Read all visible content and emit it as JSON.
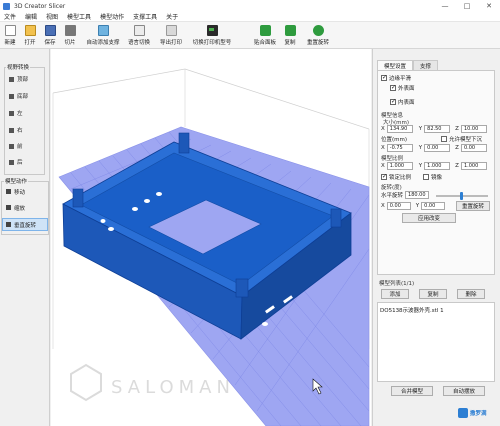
{
  "window": {
    "title": "3D Creator Slicer",
    "controls": [
      "—",
      "□",
      "✕"
    ]
  },
  "menu": [
    "文件",
    "编辑",
    "视图",
    "模型工具",
    "模型动作",
    "支撑工具",
    "关于"
  ],
  "toolbar": [
    {
      "label": "新建",
      "icon": "new-file-icon"
    },
    {
      "label": "打开",
      "icon": "folder-open-icon"
    },
    {
      "label": "保存",
      "icon": "save-icon"
    },
    {
      "label": "切片",
      "icon": "slice-icon"
    },
    {
      "label": "自动添加支撑",
      "icon": "auto-support-icon"
    },
    {
      "label": "语言切换",
      "icon": "language-icon"
    },
    {
      "label": "导出打印",
      "icon": "export-print-icon"
    },
    {
      "label": "切换打印机型号",
      "icon": "printer-icon"
    },
    {
      "label": "贴合面板",
      "icon": "fit-panel-icon"
    },
    {
      "label": "复制",
      "icon": "copy-icon"
    },
    {
      "label": "重置旋转",
      "icon": "reset-rotation-icon"
    }
  ],
  "left": {
    "view_title": "视野转换",
    "views": [
      "顶部",
      "底部",
      "左",
      "右",
      "前",
      "后"
    ],
    "action_title": "模型动作",
    "actions": [
      {
        "label": "移动",
        "selected": false
      },
      {
        "label": "缩放",
        "selected": false
      },
      {
        "label": "垂直旋转",
        "selected": true
      }
    ]
  },
  "right": {
    "tabs": [
      "模型设置",
      "支撑"
    ],
    "check_face": "边缘平滑",
    "check_outer": "外表面",
    "check_inner": "内表面",
    "info_title": "模型信息",
    "size_label": "大小(mm)",
    "size": {
      "x": "134.90",
      "y": "82.50",
      "z": "10.00"
    },
    "pos_label": "位置(mm)",
    "pos_check": "允许模型下沉",
    "pos": {
      "x": "-0.75",
      "y": "0.00",
      "z": "0.00"
    },
    "scale_label": "模型比例",
    "scale": {
      "x": "1.000",
      "y": "1.000",
      "z": "1.000"
    },
    "lock_ratio": "锁定比例",
    "mirror": "镜像",
    "rotate_label": "旋转(度)",
    "h_rotate_label": "水平旋转",
    "h_rotate_value": "180.00",
    "rot": {
      "x": "0.00",
      "y": "0.00"
    },
    "reset_rotate": "重置旋转",
    "apply": "应用改变",
    "list_title": "模型列表(1/1)",
    "list_buttons": [
      "添加",
      "复制",
      "删除"
    ],
    "list_items": [
      "DO5138示波器外壳.stl 1"
    ],
    "merge": "合并模型",
    "auto_arrange": "自动摆放"
  },
  "watermark": {
    "brand_cn": "撒罗满",
    "brand_en": "SALOMAN"
  },
  "colors": {
    "model": "#1a5fc8",
    "plate": "#9ea6f2",
    "grid": "#7c86e6"
  }
}
